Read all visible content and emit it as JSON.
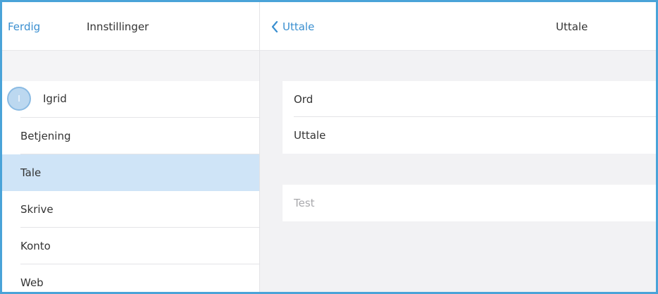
{
  "left_panel": {
    "done_label": "Ferdig",
    "title": "Innstillinger",
    "user": {
      "name": "Igrid",
      "initial": "I"
    },
    "items": [
      {
        "label": "Betjening"
      },
      {
        "label": "Tale",
        "selected": true
      },
      {
        "label": "Skrive"
      },
      {
        "label": "Konto"
      },
      {
        "label": "Web"
      }
    ]
  },
  "right_panel": {
    "back_label": "Uttale",
    "title": "Uttale",
    "fields": [
      {
        "label": "Ord"
      },
      {
        "label": "Uttale"
      }
    ],
    "test_placeholder": "Test"
  },
  "colors": {
    "accent": "#3a8fd0",
    "selected_row": "#cfe4f7",
    "frame_border": "#4aa3d8"
  }
}
